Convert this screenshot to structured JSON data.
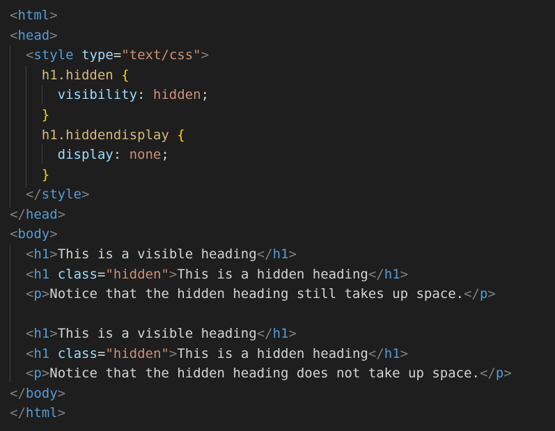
{
  "editor": {
    "theme_colors": {
      "background": "#1e1e1e",
      "tag": "#569cd6",
      "attribute": "#9cdcfe",
      "string": "#ce9178",
      "selector": "#d7ba7d",
      "brace": "#ffd700",
      "punctuation": "#808080",
      "text": "#d4d4d4"
    },
    "lines": [
      "<html>",
      "<head>",
      "  <style type=\"text/css\">",
      "    h1.hidden {",
      "      visibility: hidden;",
      "    }",
      "    h1.hiddendisplay {",
      "      display: none;",
      "    }",
      "  </style>",
      "</head>",
      "<body>",
      "  <h1>This is a visible heading</h1>",
      "  <h1 class=\"hidden\">This is a hidden heading</h1>",
      "  <p>Notice that the hidden heading still takes up space.</p>",
      "",
      "  <h1>This is a visible heading</h1>",
      "  <h1 class=\"hidden\">This is a hidden heading</h1>",
      "  <p>Notice that the hidden heading does not take up space.</p>",
      "</body>",
      "</html>"
    ],
    "tokens": {
      "l1": {
        "open": "<",
        "tag": "html",
        "close": ">"
      },
      "l2": {
        "open": "<",
        "tag": "head",
        "close": ">"
      },
      "l3": {
        "indent": "  ",
        "open": "<",
        "tag": "style",
        "space": " ",
        "attr": "type",
        "eq": "=",
        "str": "\"text/css\"",
        "close": ">"
      },
      "l4": {
        "indent": "    ",
        "sel": "h1.hidden",
        "space": " ",
        "brace": "{"
      },
      "l5": {
        "indent": "      ",
        "prop": "visibility",
        "colon": ": ",
        "val": "hidden",
        "semi": ";"
      },
      "l6": {
        "indent": "    ",
        "brace": "}"
      },
      "l7": {
        "indent": "    ",
        "sel": "h1.hiddendisplay",
        "space": " ",
        "brace": "{"
      },
      "l8": {
        "indent": "      ",
        "prop": "display",
        "colon": ": ",
        "val": "none",
        "semi": ";"
      },
      "l9": {
        "indent": "    ",
        "brace": "}"
      },
      "l10": {
        "indent": "  ",
        "open": "</",
        "tag": "style",
        "close": ">"
      },
      "l11": {
        "open": "</",
        "tag": "head",
        "close": ">"
      },
      "l12": {
        "open": "<",
        "tag": "body",
        "close": ">"
      },
      "l13": {
        "indent": "  ",
        "open": "<",
        "tag": "h1",
        "close": ">",
        "text": "This is a visible heading",
        "open2": "</",
        "tag2": "h1",
        "close2": ">"
      },
      "l14": {
        "indent": "  ",
        "open": "<",
        "tag": "h1",
        "space": " ",
        "attr": "class",
        "eq": "=",
        "str": "\"hidden\"",
        "close": ">",
        "text": "This is a hidden heading",
        "open2": "</",
        "tag2": "h1",
        "close2": ">"
      },
      "l15": {
        "indent": "  ",
        "open": "<",
        "tag": "p",
        "close": ">",
        "text": "Notice that the hidden heading still takes up space.",
        "open2": "</",
        "tag2": "p",
        "close2": ">"
      },
      "l17": {
        "indent": "  ",
        "open": "<",
        "tag": "h1",
        "close": ">",
        "text": "This is a visible heading",
        "open2": "</",
        "tag2": "h1",
        "close2": ">"
      },
      "l18": {
        "indent": "  ",
        "open": "<",
        "tag": "h1",
        "space": " ",
        "attr": "class",
        "eq": "=",
        "str": "\"hidden\"",
        "close": ">",
        "text": "This is a hidden heading",
        "open2": "</",
        "tag2": "h1",
        "close2": ">"
      },
      "l19": {
        "indent": "  ",
        "open": "<",
        "tag": "p",
        "close": ">",
        "text": "Notice that the hidden heading does not take up space.",
        "open2": "</",
        "tag2": "p",
        "close2": ">"
      },
      "l20": {
        "open": "</",
        "tag": "body",
        "close": ">"
      },
      "l21": {
        "open": "</",
        "tag": "html",
        "close": ">"
      }
    }
  }
}
